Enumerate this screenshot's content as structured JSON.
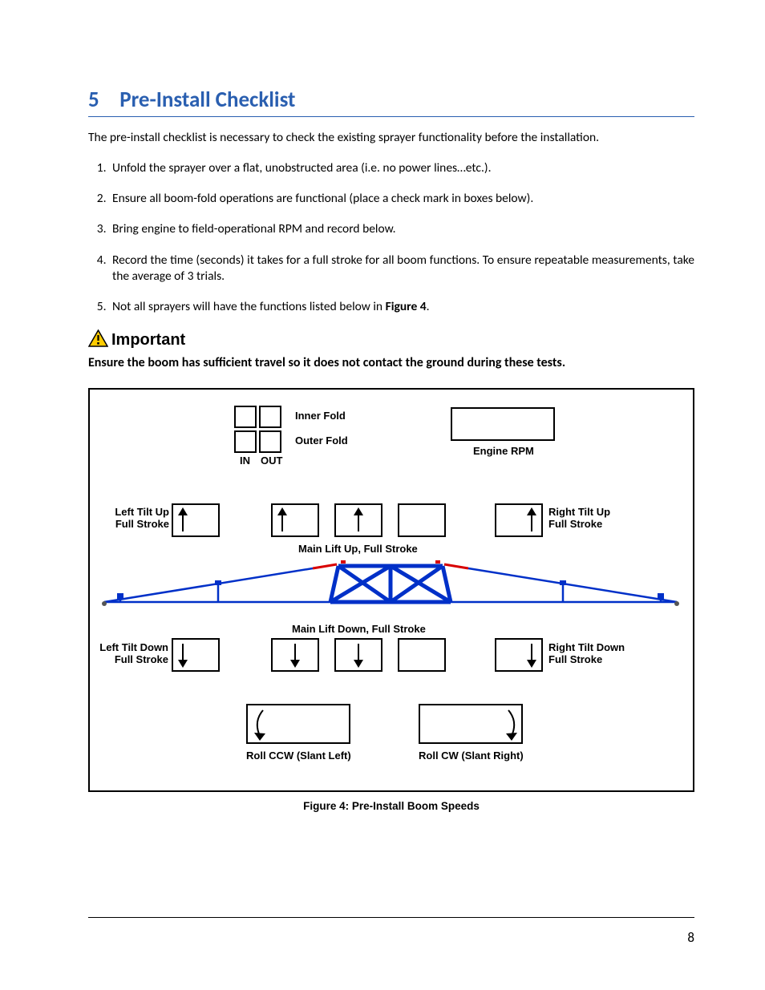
{
  "chapter": {
    "number": "5",
    "title": "Pre-Install Checklist"
  },
  "intro": "The pre-install checklist is necessary to check the existing sprayer functionality before the installation.",
  "steps": [
    "Unfold the sprayer over a flat, unobstructed area (i.e. no power lines…etc.).",
    "Ensure all boom-fold operations are functional (place a check mark in boxes below).",
    "Bring engine to field-operational RPM and record below.",
    "Record the time (seconds) it takes for a full stroke for all boom functions.  To ensure repeatable measurements, take the average of 3 trials.",
    "Not all sprayers will have the functions listed below in "
  ],
  "figure_ref": "Figure 4",
  "step5_end": ".",
  "important": {
    "label": "Important",
    "text": "Ensure the boom has sufficient travel so it does not contact the ground during these tests."
  },
  "figure": {
    "labels": {
      "inner_fold": "Inner Fold",
      "outer_fold": "Outer Fold",
      "in": "IN",
      "out": "OUT",
      "engine_rpm": "Engine RPM",
      "left_tilt_up": "Left Tilt Up",
      "full_stroke": "Full Stroke",
      "right_tilt_up": "Right Tilt Up",
      "main_lift_up": "Main Lift Up, Full Stroke",
      "main_lift_down": "Main Lift Down, Full Stroke",
      "left_tilt_down": "Left Tilt Down",
      "right_tilt_down": "Right Tilt  Down",
      "roll_ccw": "Roll CCW (Slant Left)",
      "roll_cw": "Roll CW (Slant Right)"
    },
    "caption": "Figure 4: Pre-Install Boom Speeds"
  },
  "page_number": "8"
}
